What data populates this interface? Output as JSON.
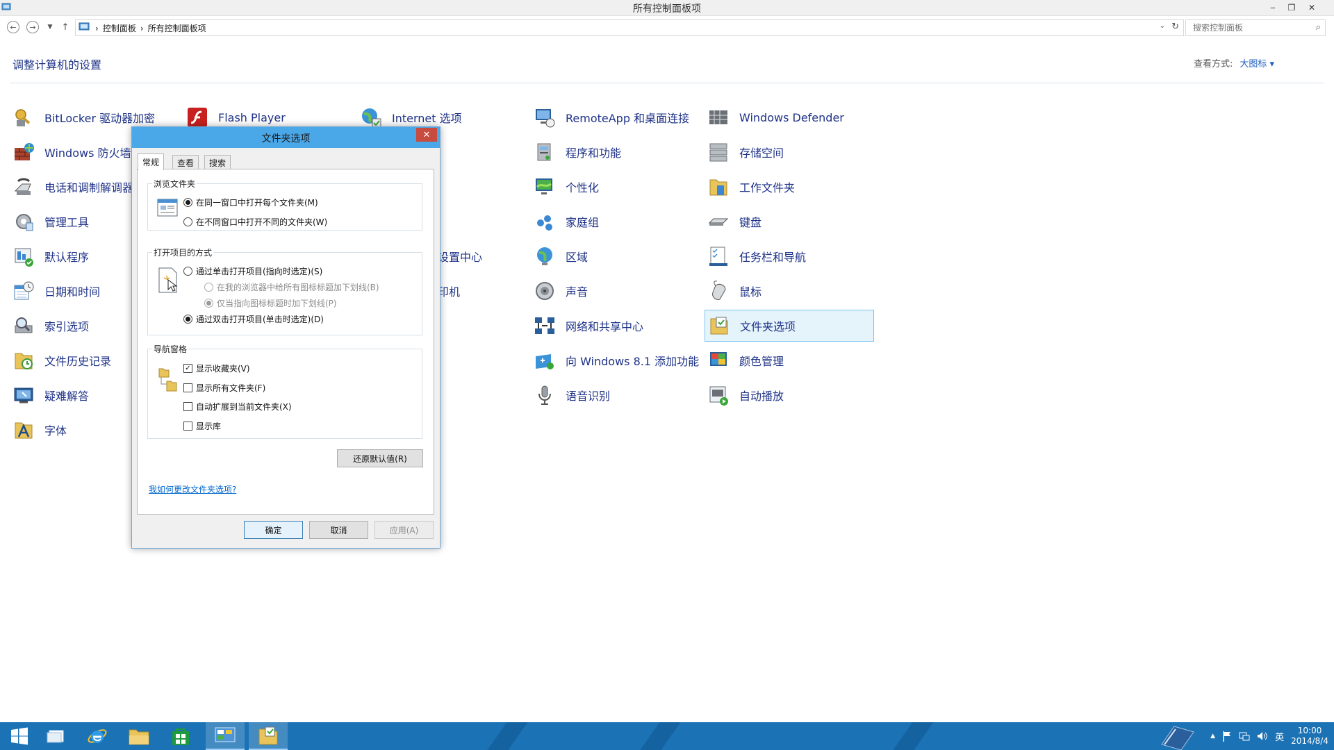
{
  "window": {
    "title": "所有控制面板项",
    "controls": {
      "minimize": "‒",
      "restore": "❐",
      "close": "✕"
    }
  },
  "address": {
    "back_icon": "arrow-left-icon",
    "forward_icon": "arrow-right-icon",
    "breadcrumb": [
      "控制面板",
      "所有控制面板项"
    ],
    "separator": "›",
    "search_placeholder": "搜索控制面板"
  },
  "header": {
    "title": "调整计算机的设置",
    "view_label": "查看方式:",
    "view_value": "大图标 ▾"
  },
  "items": {
    "col1": [
      "BitLocker 驱动器加密",
      "Windows 防火墙",
      "电话和调制解调器",
      "管理工具",
      "默认程序",
      "日期和时间",
      "索引选项",
      "文件历史记录",
      "疑难解答",
      "字体"
    ],
    "col2_row1": "Flash Player",
    "col3_row1": "Internet 选项",
    "col3_row5_tail": "设置中心",
    "col3_row6_tail": "印机",
    "col4": [
      "RemoteApp 和桌面连接",
      "程序和功能",
      "个性化",
      "家庭组",
      "区域",
      "声音",
      "网络和共享中心",
      "向 Windows 8.1 添加功能",
      "语音识别"
    ],
    "col5": [
      "Windows Defender",
      "存储空间",
      "工作文件夹",
      "键盘",
      "任务栏和导航",
      "鼠标",
      "文件夹选项",
      "颜色管理",
      "自动播放"
    ]
  },
  "dialog": {
    "title": "文件夹选项",
    "close": "✕",
    "tabs": [
      "常规",
      "查看",
      "搜索"
    ],
    "browse": {
      "legend": "浏览文件夹",
      "options": [
        "在同一窗口中打开每个文件夹(M)",
        "在不同窗口中打开不同的文件夹(W)"
      ]
    },
    "open_items": {
      "legend": "打开项目的方式",
      "single_click": "通过单击打开项目(指向时选定)(S)",
      "underline_all": "在我的浏览器中给所有图标标题加下划线(B)",
      "underline_point": "仅当指向图标标题时加下划线(P)",
      "double_click": "通过双击打开项目(单击时选定)(D)"
    },
    "nav_pane": {
      "legend": "导航窗格",
      "options": [
        "显示收藏夹(V)",
        "显示所有文件夹(F)",
        "自动扩展到当前文件夹(X)",
        "显示库"
      ]
    },
    "restore_defaults": "还原默认值(R)",
    "help_link": "我如何更改文件夹选项?",
    "ok": "确定",
    "cancel": "取消",
    "apply": "应用(A)"
  },
  "taskbar": {
    "tray_overflow": "▲",
    "ime": "英",
    "time": "10:00",
    "date": "2014/8/4"
  }
}
